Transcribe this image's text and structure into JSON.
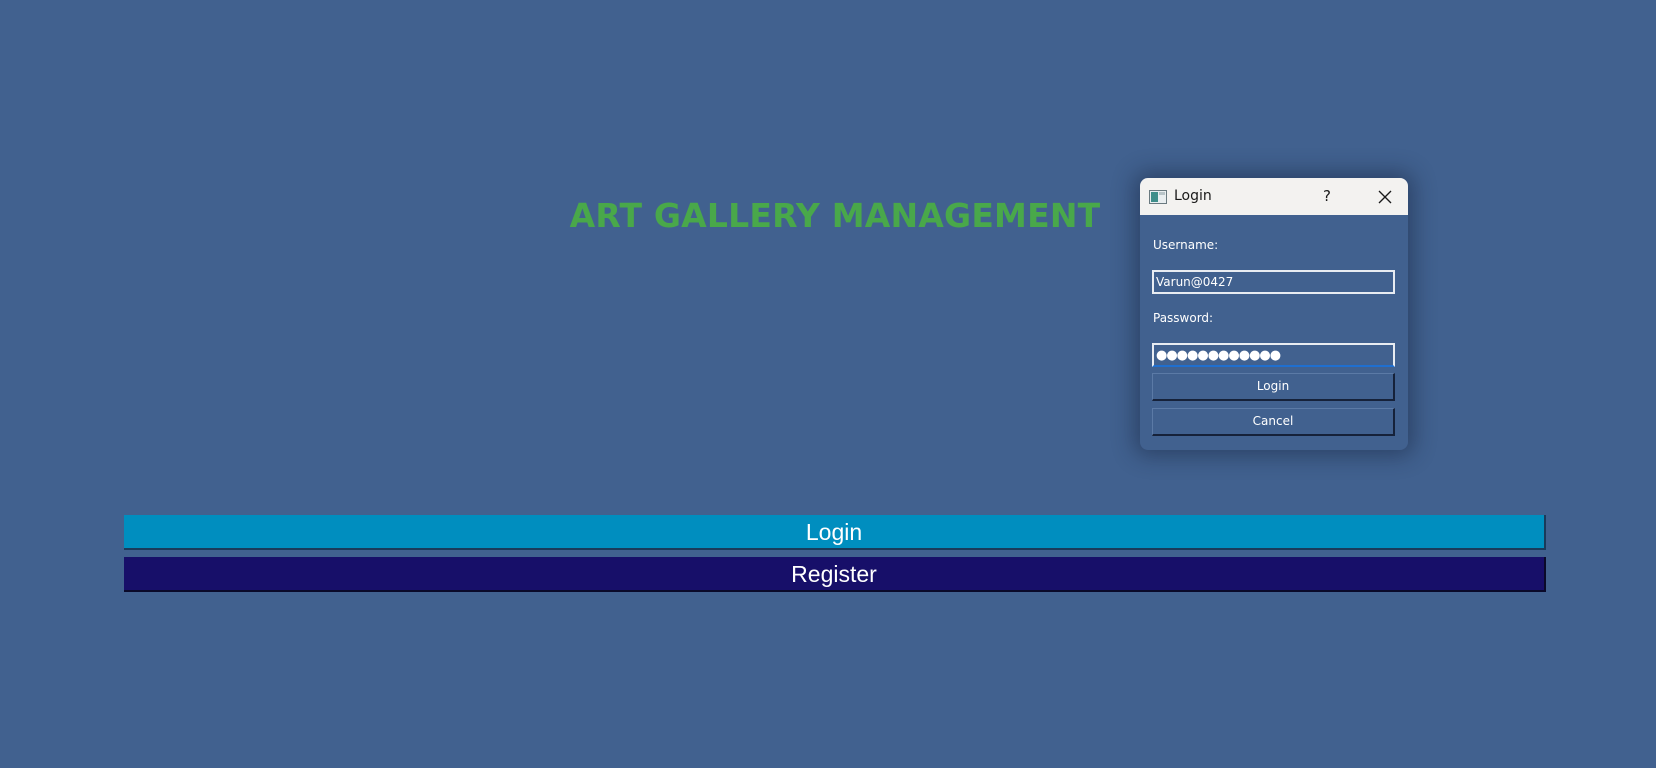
{
  "app": {
    "title": "ART GALLERY MANAGEMENT",
    "login_label": "Login",
    "register_label": "Register"
  },
  "dialog": {
    "title": "Login",
    "help_label": "?",
    "username_label": "Username:",
    "username_value": "Varun@0427",
    "password_label": "Password:",
    "password_value": "●●●●●●●●●●●●",
    "login_label": "Login",
    "cancel_label": "Cancel"
  },
  "colors": {
    "background": "#41618f",
    "title_green": "#49a84a",
    "login_button": "#008ebf",
    "register_button": "#170f69",
    "titlebar": "#f3f2f0"
  },
  "icons": {
    "app_icon": "window-app-icon",
    "close_icon": "close-icon"
  }
}
